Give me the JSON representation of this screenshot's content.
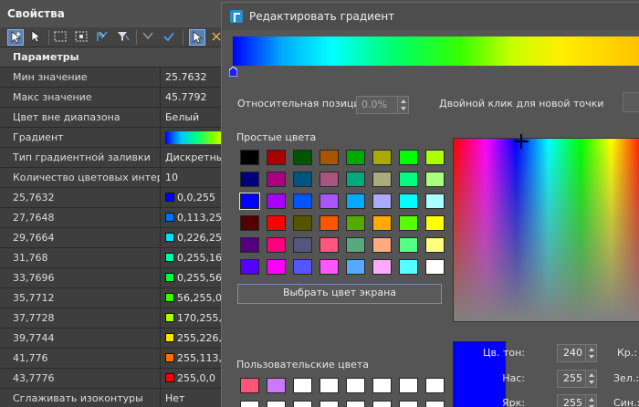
{
  "props": {
    "title": "Свойства",
    "header": "Параметры",
    "rows": [
      {
        "key": "Мин значение",
        "value": "25.7632"
      },
      {
        "key": "Макс значение",
        "value": "45.7792"
      },
      {
        "key": "Цвет вне диапазона",
        "value": "Белый"
      },
      {
        "key": "Градиент",
        "value": ""
      },
      {
        "key": "Тип градиентной заливки",
        "value": "Дискретный"
      },
      {
        "key": "Количество цветовых интер...",
        "value": "10"
      },
      {
        "key": "25,7632",
        "value": "0,0,255",
        "color": "#0000ff"
      },
      {
        "key": "27,7648",
        "value": "0,113,255",
        "color": "#0071ff"
      },
      {
        "key": "29,7664",
        "value": "0,226,255",
        "color": "#00e2ff"
      },
      {
        "key": " 31,768",
        "value": "0,255,168",
        "color": "#00ffa8"
      },
      {
        "key": "33,7696",
        "value": "0,255,56",
        "color": "#00ff38"
      },
      {
        "key": "35,7712",
        "value": "56,255,0",
        "color": "#38ff00"
      },
      {
        "key": "37,7728",
        "value": "170,255,0",
        "color": "#aaff00"
      },
      {
        "key": "39,7744",
        "value": "255,226,0",
        "color": "#ffe200"
      },
      {
        "key": " 41,776",
        "value": "255,113,0",
        "color": "#ff7100"
      },
      {
        "key": "43,7776",
        "value": "255,0,0",
        "color": "#ff0000"
      },
      {
        "key": "Сглаживать изоконтуры",
        "value": "Нет"
      }
    ]
  },
  "dialog": {
    "title": "Редактировать градиент",
    "rel_pos_label": "Относительная позиция",
    "rel_pos_value": "0.0%",
    "dblclick_hint": "Двойной клик для новой точки",
    "basic_colors_label": "Простые цвета",
    "basic_colors": [
      [
        "#000000",
        "#aa0000",
        "#005500",
        "#aa5500",
        "#00aa00",
        "#aaaa00",
        "#00ff00",
        "#aaff00"
      ],
      [
        "#00007f",
        "#aa007f",
        "#00557f",
        "#aa557f",
        "#00aa7f",
        "#aaaa7f",
        "#00ff7f",
        "#aaff7f"
      ],
      [
        "#0000ff",
        "#aa00ff",
        "#0055ff",
        "#aa55ff",
        "#00aaff",
        "#aaaaff",
        "#00ffff",
        "#aaffff"
      ],
      [
        "#550000",
        "#ff0000",
        "#555500",
        "#ff5500",
        "#55aa00",
        "#ffaa00",
        "#55ff00",
        "#ffff00"
      ],
      [
        "#55007f",
        "#ff007f",
        "#55557f",
        "#ff557f",
        "#55aa7f",
        "#ffaa7f",
        "#55ff7f",
        "#ffff7f"
      ],
      [
        "#5500ff",
        "#ff00ff",
        "#5555ff",
        "#ff55ff",
        "#55aaff",
        "#ffaaff",
        "#55ffff",
        "#ffffff"
      ]
    ],
    "pick_screen_label": "Выбрать цвет экрана",
    "custom_colors_label": "Пользовательские цвета",
    "custom_colors": [
      "#ff5577",
      "#cc77ff",
      "#ffffff",
      "#ffffff",
      "#ffffff",
      "#ffffff",
      "#ffffff",
      "#ffffff"
    ],
    "hue_label": "Цв. тон:",
    "hue_value": "240",
    "sat_label": "Нас:",
    "sat_value": "255",
    "val_label": "Ярк:",
    "val_value": "255",
    "red_label": "Кр.:",
    "green_label": "Зел.:",
    "blue_label": "Син.:"
  }
}
